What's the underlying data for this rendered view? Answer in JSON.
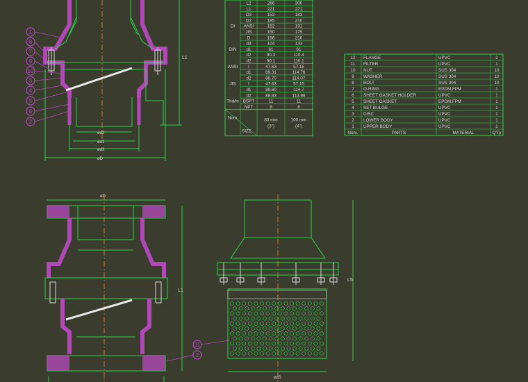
{
  "colors": {
    "background": "#3a3c2e",
    "outline": "#2bd64a",
    "hatch": "#b048b8",
    "centerline": "#c87830",
    "text": "#d8d8d8",
    "disc": "#e8e8e8"
  },
  "dimensions": {
    "top_view": [
      "ød2",
      "ød1",
      "ød3",
      "øD"
    ],
    "bottom_left_top": "øD",
    "bottom_right_bottom": "ød3",
    "height_label": "L1",
    "height_label_right": "L5"
  },
  "balloons_top": [
    "1",
    "8",
    "7",
    "9",
    "10",
    "3",
    "4",
    "5",
    "6",
    "2"
  ],
  "balloons_bottom": [
    "11",
    "2"
  ],
  "size_table": {
    "rows": [
      {
        "group": "",
        "sub": "",
        "key": "L2",
        "v80": "266",
        "v100": "300"
      },
      {
        "group": "",
        "sub": "",
        "key": "L1",
        "v80": "221",
        "v100": "271"
      },
      {
        "group": "",
        "sub": "",
        "key": "D3",
        "v80": "153",
        "v100": "183"
      },
      {
        "group": "",
        "sub": "",
        "key": "D2",
        "v80": "185",
        "v100": "210"
      },
      {
        "group": "DI",
        "sub": "ANSI",
        "key": "",
        "v80": "152",
        "v100": "191"
      },
      {
        "group": "",
        "sub": "JIS",
        "key": "",
        "v80": "150",
        "v100": "175"
      },
      {
        "group": "",
        "sub": "",
        "key": "D",
        "v80": "196",
        "v100": "210"
      },
      {
        "group": "",
        "sub": "",
        "key": "d3",
        "v80": "104",
        "v100": "133"
      },
      {
        "group": "DIN",
        "sub": "",
        "key": "d1",
        "v80": "81",
        "v100": "61"
      },
      {
        "group": "",
        "sub": "",
        "key": "d2",
        "v80": "90.3",
        "v100": "110.4"
      },
      {
        "group": "",
        "sub": "",
        "key": "d2",
        "v80": "90.1",
        "v100": "110.1"
      },
      {
        "group": "ANSI",
        "sub": "",
        "key": "l",
        "v80": "47.63",
        "v100": "57.15"
      },
      {
        "group": "",
        "sub": "",
        "key": "d1",
        "v80": "89.31",
        "v100": "114.76"
      },
      {
        "group": "",
        "sub": "",
        "key": "d2",
        "v80": "88.70",
        "v100": "114.07"
      },
      {
        "group": "JIS",
        "sub": "",
        "key": "l",
        "v80": "47.63",
        "v100": "57.15"
      },
      {
        "group": "",
        "sub": "",
        "key": "d1",
        "v80": "89.60",
        "v100": "114.7"
      },
      {
        "group": "",
        "sub": "",
        "key": "d2",
        "v80": "88.83",
        "v100": "113.98"
      },
      {
        "group": "Thd/in",
        "sub": "BSPT",
        "key": "",
        "v80": "11",
        "v100": "11"
      },
      {
        "group": "",
        "sub": "NPT",
        "key": "",
        "v80": "8",
        "v100": "8"
      }
    ],
    "footer": {
      "nom": "Nom.",
      "size": "SIZE",
      "c80": "80 mm",
      "c80b": "(3\")",
      "c100": "100 mm",
      "c100b": "(4\")"
    }
  },
  "parts_table": {
    "rows": [
      {
        "no": "12",
        "part": "FLANGE",
        "material": "UPVC",
        "qty": "2"
      },
      {
        "no": "11",
        "part": "FILTER",
        "material": "UPVC",
        "qty": "1"
      },
      {
        "no": "10",
        "part": "NUT",
        "material": "SUS 304",
        "qty": "10"
      },
      {
        "no": "9",
        "part": "WASHER",
        "material": "SUS 304",
        "qty": "10"
      },
      {
        "no": "8",
        "part": "BOLT",
        "material": "SUS 304",
        "qty": "10"
      },
      {
        "no": "7",
        "part": "O-RING",
        "material": "EPDM,FPM",
        "qty": "1"
      },
      {
        "no": "6",
        "part": "SHEET GASKET HOLDER",
        "material": "UPVC",
        "qty": "1"
      },
      {
        "no": "5",
        "part": "SHEET GASKET",
        "material": "EPDM,FPM",
        "qty": "1"
      },
      {
        "no": "4",
        "part": "SET BULGE",
        "material": "UPVC",
        "qty": "1"
      },
      {
        "no": "3",
        "part": "DISC",
        "material": "UPVC",
        "qty": "1"
      },
      {
        "no": "2",
        "part": "LOWER BODY",
        "material": "UPVC",
        "qty": "1"
      },
      {
        "no": "1",
        "part": "UPPER BODY",
        "material": "UPVC",
        "qty": "1"
      }
    ],
    "header": {
      "no": "Nom.",
      "part": "PARTS",
      "material": "MATERIAL",
      "qty": "Q'Ty"
    }
  }
}
